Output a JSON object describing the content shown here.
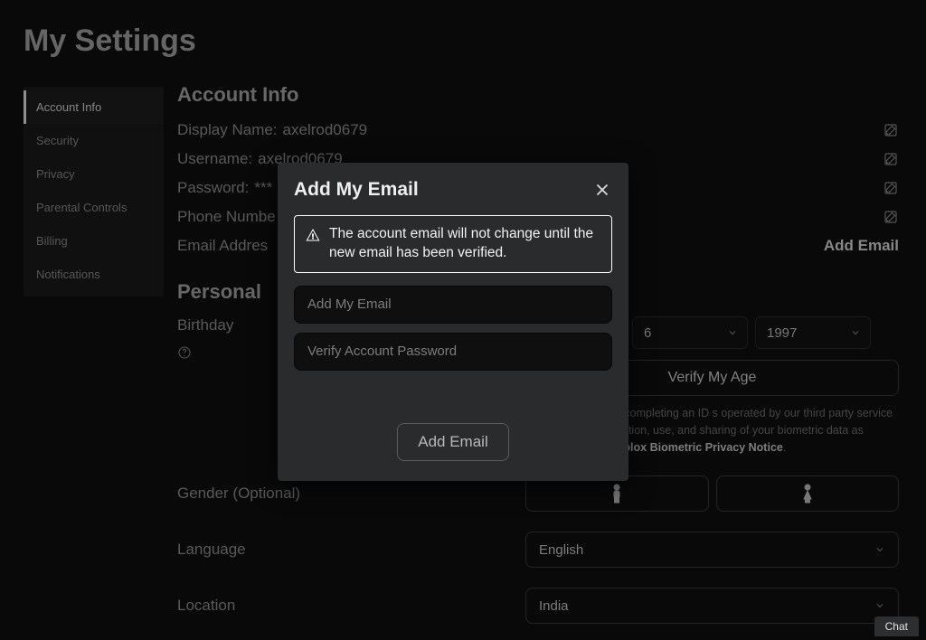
{
  "page": {
    "title": "My Settings"
  },
  "sidebar": {
    "items": [
      {
        "label": "Account Info",
        "active": true
      },
      {
        "label": "Security"
      },
      {
        "label": "Privacy"
      },
      {
        "label": "Parental Controls"
      },
      {
        "label": "Billing"
      },
      {
        "label": "Notifications"
      }
    ]
  },
  "account": {
    "heading": "Account Info",
    "display_name_label": "Display Name:",
    "display_name_value": "axelrod0679",
    "username_label": "Username:",
    "username_value": "axelrod0679",
    "password_label": "Password:",
    "password_value": "***",
    "phone_label": "Phone Numbe",
    "email_label": "Email Addres",
    "add_email_link": "Add Email"
  },
  "personal": {
    "heading": "Personal",
    "birthday_label": "Birthday",
    "birthday": {
      "month": "",
      "day": "6",
      "year": "1997"
    },
    "verify_age_button": "Verify My Age",
    "verify_caption_partial": "My Age' you will be completing an ID s operated by our third party service consent to the collection, use, and sharing of your biometric data as described in the ",
    "verify_caption_link": "Roblox Biometric Privacy Notice",
    "verify_caption_tail": ".",
    "gender_label": "Gender (Optional)",
    "language_label": "Language",
    "language_value": "English",
    "location_label": "Location",
    "location_value": "India"
  },
  "modal": {
    "title": "Add My Email",
    "warning": "The account email will not change until the new email has been verified.",
    "email_placeholder": "Add My Email",
    "password_placeholder": "Verify Account Password",
    "submit": "Add Email"
  },
  "chat": {
    "label": "Chat"
  }
}
